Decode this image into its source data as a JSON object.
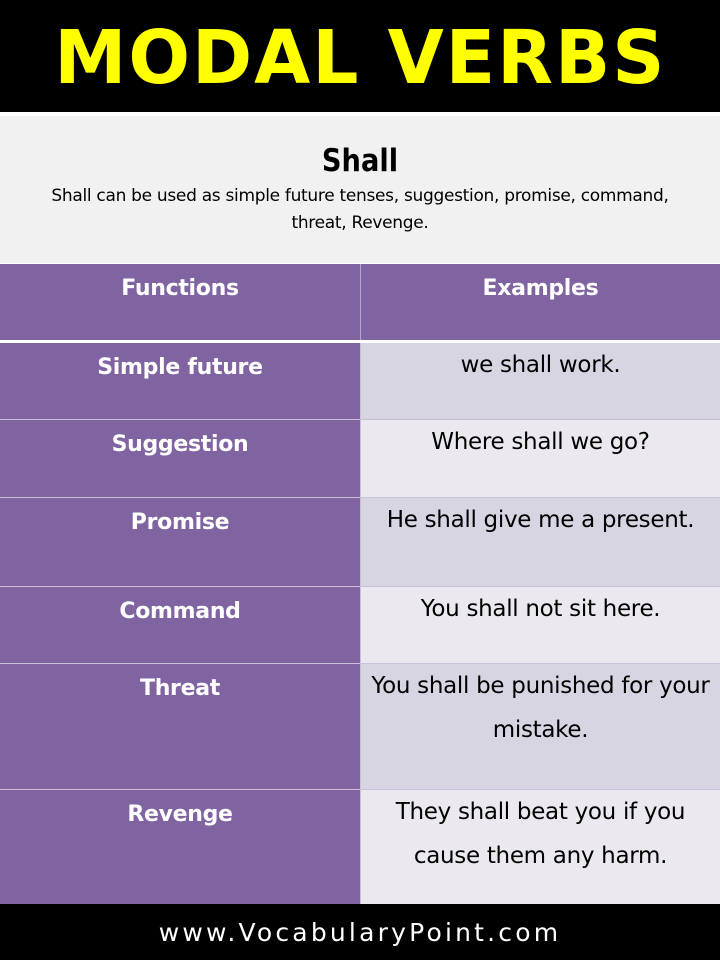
{
  "title": "MODAL VERBS",
  "intro": {
    "heading": "Shall",
    "description": "Shall can be used as simple future tenses, suggestion, promise, command, threat, Revenge."
  },
  "table": {
    "headers": [
      "Functions",
      "Examples"
    ],
    "rows": [
      {
        "function": "Simple future",
        "example": "we shall work."
      },
      {
        "function": "Suggestion",
        "example": "Where shall we go?"
      },
      {
        "function": "Promise",
        "example": "He shall give me a present."
      },
      {
        "function": "Command",
        "example": "You shall not sit here."
      },
      {
        "function": "Threat",
        "example": "You shall be punished for your mistake."
      },
      {
        "function": "Revenge",
        "example": "They shall beat you if you cause them any harm."
      }
    ]
  },
  "footer": "www.VocabularyPoint.com",
  "colors": {
    "title_text": "#ffff00",
    "band": "#000000",
    "purple": "#8064a2",
    "row_odd": "#d8d5e3",
    "row_even": "#ebe9ef",
    "intro_bg": "#f1f1f1"
  }
}
